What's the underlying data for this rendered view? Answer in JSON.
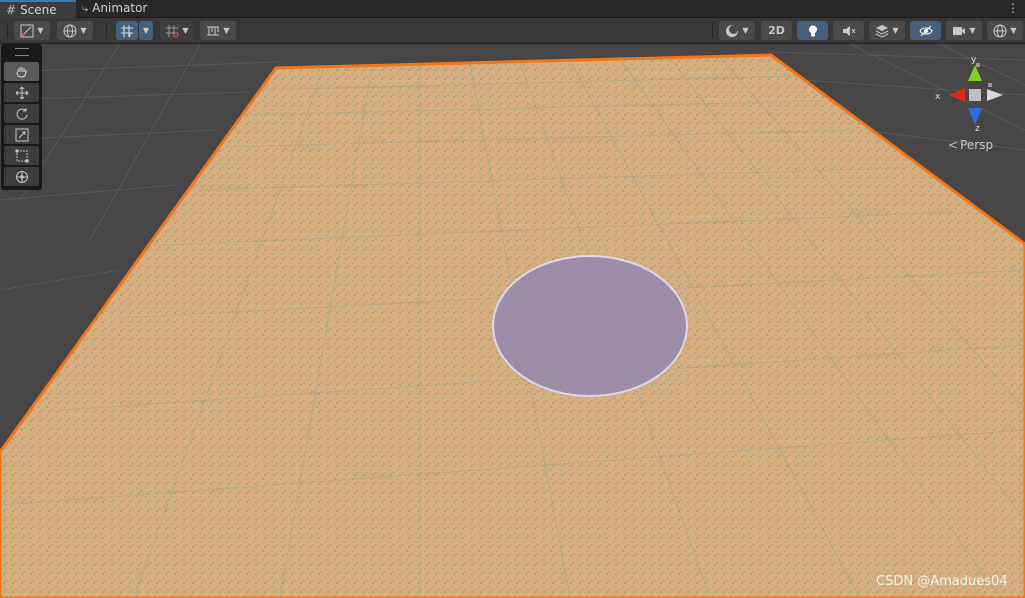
{
  "tabs": [
    {
      "label": "Scene",
      "icon": "grid-hash-icon"
    },
    {
      "label": "Animator",
      "icon": "animator-icon"
    }
  ],
  "toolbar": {
    "two_d_label": "2D"
  },
  "tools": [
    "hand-tool",
    "move-tool",
    "rotate-tool",
    "scale-tool",
    "rect-tool",
    "transform-tool"
  ],
  "gizmo": {
    "x": "x",
    "y": "y",
    "z": "z",
    "projection": "Persp"
  },
  "colors": {
    "selection_outline": "#f07618",
    "circle_fill": "#9487b0",
    "accent": "#3a79bb"
  },
  "watermark": "CSDN @Amadues04"
}
